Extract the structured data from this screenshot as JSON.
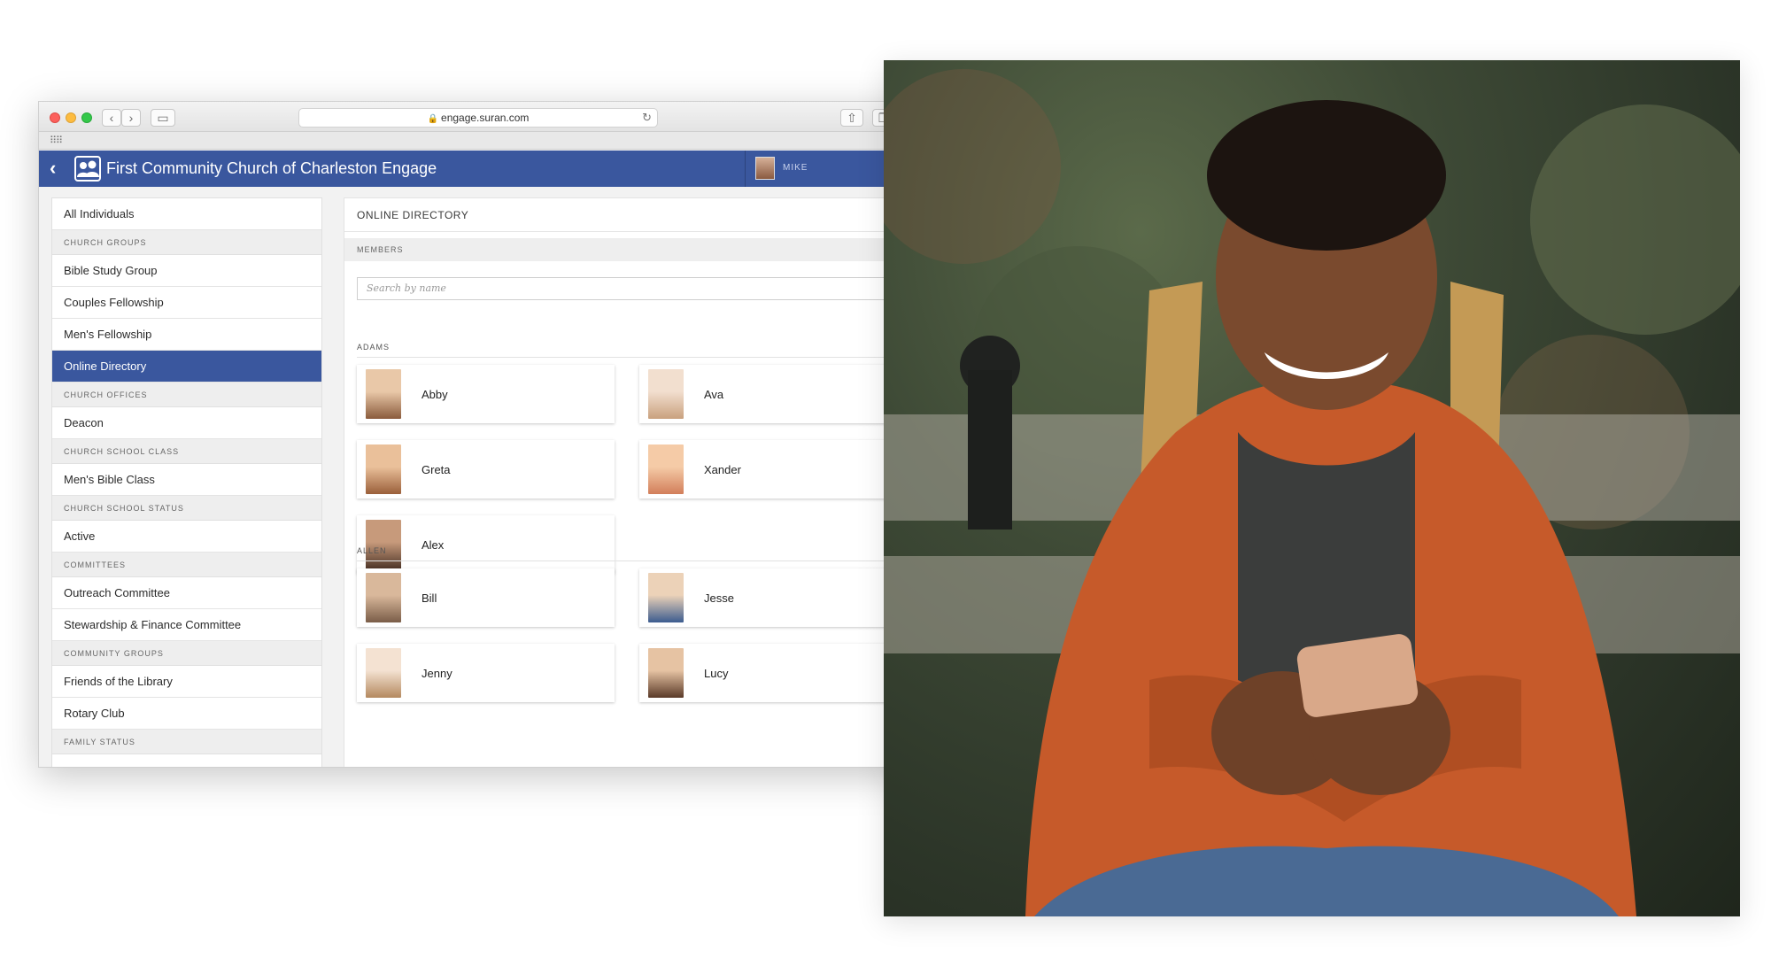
{
  "browser": {
    "url": "engage.suran.com",
    "more_label": ">>",
    "new_tab_label": "+"
  },
  "app": {
    "title": "First Community Church of Charleston Engage",
    "user": "MIKE",
    "header_color": "#3a579e"
  },
  "sidebar": {
    "rows": [
      {
        "type": "item",
        "label": "All Individuals"
      },
      {
        "type": "section",
        "label": "CHURCH GROUPS"
      },
      {
        "type": "item",
        "label": "Bible Study Group"
      },
      {
        "type": "item",
        "label": "Couples Fellowship"
      },
      {
        "type": "item",
        "label": "Men's Fellowship"
      },
      {
        "type": "item",
        "label": "Online Directory",
        "active": true
      },
      {
        "type": "section",
        "label": "CHURCH OFFICES"
      },
      {
        "type": "item",
        "label": "Deacon"
      },
      {
        "type": "section",
        "label": "CHURCH SCHOOL CLASS"
      },
      {
        "type": "item",
        "label": "Men's Bible Class"
      },
      {
        "type": "section",
        "label": "CHURCH SCHOOL STATUS"
      },
      {
        "type": "item",
        "label": "Active"
      },
      {
        "type": "section",
        "label": "COMMITTEES"
      },
      {
        "type": "item",
        "label": "Outreach Committee"
      },
      {
        "type": "item",
        "label": "Stewardship & Finance Committee"
      },
      {
        "type": "section",
        "label": "COMMUNITY GROUPS"
      },
      {
        "type": "item",
        "label": "Friends of the Library"
      },
      {
        "type": "item",
        "label": "Rotary Club"
      },
      {
        "type": "section",
        "label": "FAMILY STATUS"
      }
    ]
  },
  "main": {
    "heading": "ONLINE DIRECTORY",
    "section_label": "MEMBERS",
    "search_placeholder": "Search by name",
    "families": [
      {
        "name": "ADAMS",
        "members": [
          "Abby",
          "Ava",
          "Greta",
          "Xander",
          "Alex"
        ]
      },
      {
        "name": "ALLEN",
        "members": [
          "Bill",
          "Jesse",
          "Jenny",
          "Lucy"
        ]
      }
    ]
  }
}
